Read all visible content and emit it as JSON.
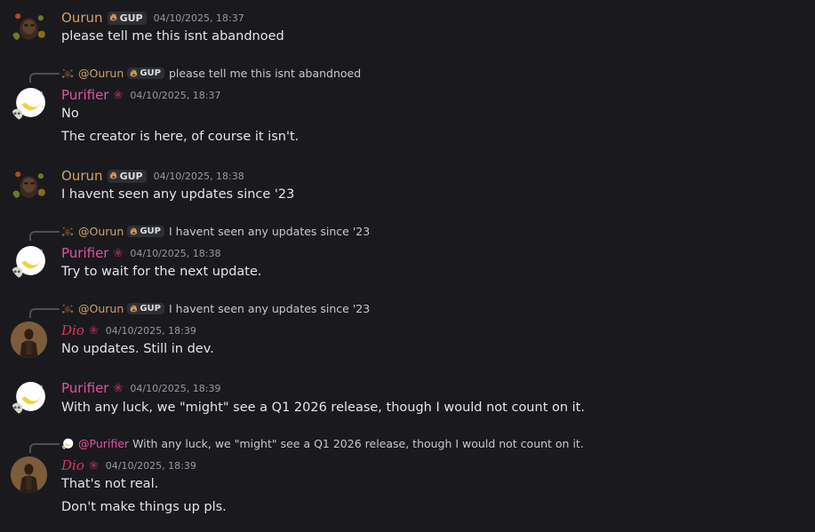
{
  "tag_label": "GUP",
  "messages": [
    {
      "author": "Ourun",
      "timestamp": "04/10/2025, 18:37",
      "lines": [
        "please tell me this isnt abandnoed"
      ]
    },
    {
      "reply": {
        "author": "@Ourun",
        "text": "please tell me this isnt abandnoed"
      },
      "author": "Purifier",
      "timestamp": "04/10/2025, 18:37",
      "lines": [
        "No",
        "The creator is here, of course it isn't."
      ]
    },
    {
      "author": "Ourun",
      "timestamp": "04/10/2025, 18:38",
      "lines": [
        "I havent seen any updates since '23"
      ]
    },
    {
      "reply": {
        "author": "@Ourun",
        "text": "I havent seen any updates since '23"
      },
      "author": "Purifier",
      "timestamp": "04/10/2025, 18:38",
      "lines": [
        "Try to wait for the next update."
      ]
    },
    {
      "reply": {
        "author": "@Ourun",
        "text": "I havent seen any updates since '23"
      },
      "author": "Dio",
      "timestamp": "04/10/2025, 18:39",
      "lines": [
        "No updates. Still in dev."
      ]
    },
    {
      "author": "Purifier",
      "timestamp": "04/10/2025, 18:39",
      "lines": [
        "With any luck, we \"might\" see a Q1 2026 release, though I would not count on it."
      ]
    },
    {
      "reply": {
        "author": "@Purifier",
        "text": "With any luck, we \"might\" see a Q1 2026 release, though I would not count on it."
      },
      "author": "Dio",
      "timestamp": "04/10/2025, 18:39",
      "lines": [
        "That's not real.",
        "Don't make things up pls."
      ]
    }
  ],
  "colors": {
    "ourun": "#d3a06b",
    "purifier": "#e052a6",
    "dio": "#d6395f",
    "background": "#1a1a1e"
  },
  "icons": {
    "server_tag": "fire-tag-icon",
    "role": "crest-role-icon"
  }
}
